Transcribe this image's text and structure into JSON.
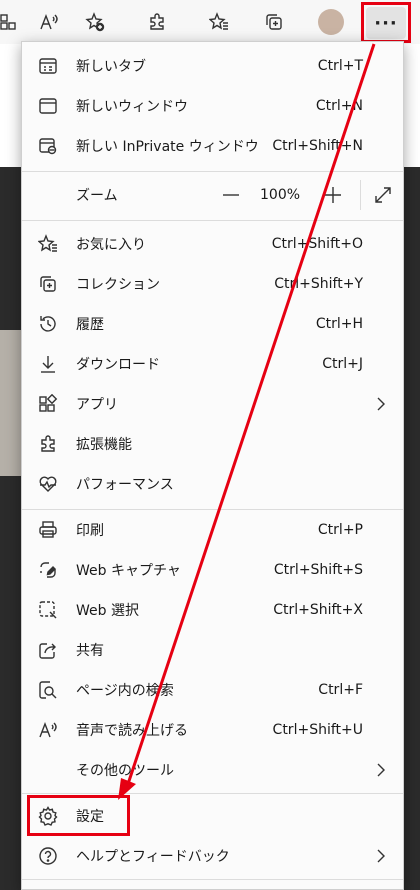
{
  "colors": {
    "highlight": "#e60012",
    "menu_bg": "#fbfbfb",
    "toolbar_bg": "#f7f7f7"
  },
  "toolbar": {
    "icons": [
      "app-grid-icon",
      "read-aloud-icon",
      "add-favorite-icon",
      "extensions-icon",
      "favorites-icon",
      "collections-icon",
      "profile-avatar",
      "more-icon"
    ],
    "more_label": "···"
  },
  "menu": {
    "items": [
      {
        "icon": "new-tab-icon",
        "label": "新しいタブ",
        "shortcut": "Ctrl+T"
      },
      {
        "icon": "new-window-icon",
        "label": "新しいウィンドウ",
        "shortcut": "Ctrl+N"
      },
      {
        "icon": "inprivate-window-icon",
        "label": "新しい InPrivate ウィンドウ",
        "shortcut": "Ctrl+Shift+N"
      },
      {
        "icon": "favorites-icon",
        "label": "お気に入り",
        "shortcut": "Ctrl+Shift+O"
      },
      {
        "icon": "collections-icon",
        "label": "コレクション",
        "shortcut": "Ctrl+Shift+Y"
      },
      {
        "icon": "history-icon",
        "label": "履歴",
        "shortcut": "Ctrl+H"
      },
      {
        "icon": "download-icon",
        "label": "ダウンロード",
        "shortcut": "Ctrl+J"
      },
      {
        "icon": "apps-icon",
        "label": "アプリ",
        "shortcut": ""
      },
      {
        "icon": "extensions-icon",
        "label": "拡張機能",
        "shortcut": ""
      },
      {
        "icon": "performance-icon",
        "label": "パフォーマンス",
        "shortcut": ""
      },
      {
        "icon": "print-icon",
        "label": "印刷",
        "shortcut": "Ctrl+P"
      },
      {
        "icon": "web-capture-icon",
        "label": "Web キャプチャ",
        "shortcut": "Ctrl+Shift+S"
      },
      {
        "icon": "web-select-icon",
        "label": "Web 選択",
        "shortcut": "Ctrl+Shift+X"
      },
      {
        "icon": "share-icon",
        "label": "共有",
        "shortcut": ""
      },
      {
        "icon": "find-on-page-icon",
        "label": "ページ内の検索",
        "shortcut": "Ctrl+F"
      },
      {
        "icon": "read-aloud-icon",
        "label": "音声で読み上げる",
        "shortcut": "Ctrl+Shift+U"
      },
      {
        "icon": "",
        "label": "その他のツール",
        "shortcut": ""
      },
      {
        "icon": "settings-icon",
        "label": "設定",
        "shortcut": ""
      },
      {
        "icon": "help-icon",
        "label": "ヘルプとフィードバック",
        "shortcut": ""
      }
    ],
    "zoom": {
      "label": "ズーム",
      "value": "100%",
      "minus": "−",
      "plus": "+"
    }
  }
}
